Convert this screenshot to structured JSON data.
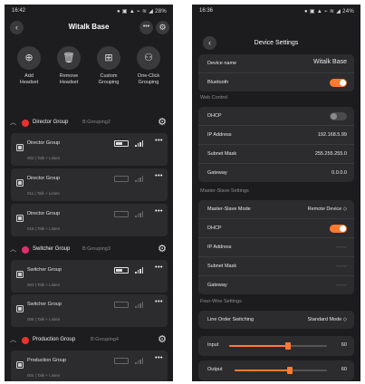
{
  "left": {
    "status": {
      "time": "16:42",
      "icons": "● ▣ ▲ ⌁ ≋ ◢ 28%"
    },
    "title": "Witalk Base",
    "actions": [
      {
        "label": "Add\nHeadset",
        "icon": "add-icon"
      },
      {
        "label": "Remove\nHeadset",
        "icon": "trash-icon"
      },
      {
        "label": "Custom\nGrouping",
        "icon": "grid-icon"
      },
      {
        "label": "One-Click\nGrouping",
        "icon": "people-icon"
      }
    ],
    "groups": [
      {
        "name": "Director Group",
        "number": "B:Grouping2",
        "color": "#e8332f",
        "devices": [
          {
            "name": "Director Group",
            "sub": "002 | Talk + Listen",
            "battery": 0.6,
            "signal": 4
          },
          {
            "name": "Director Group",
            "sub": "011 | Talk + Listen",
            "battery": 0,
            "signal": 0
          },
          {
            "name": "Director Group",
            "sub": "016 | Talk + Listen",
            "battery": 0,
            "signal": 0
          }
        ]
      },
      {
        "name": "Switcher Group",
        "number": "B:Grouping3",
        "color": "#e0306d",
        "devices": [
          {
            "name": "Switcher Group",
            "sub": "003 | Talk + Listen",
            "battery": 0.6,
            "signal": 4
          },
          {
            "name": "Switcher Group",
            "sub": "006 | Talk + Listen",
            "battery": 0,
            "signal": 0
          }
        ]
      },
      {
        "name": "Production Group",
        "number": "B:Grouping4",
        "color": "#e8332f",
        "devices": [
          {
            "name": "Production Group",
            "sub": "004 | Talk + Listen",
            "battery": 0,
            "signal": 0
          }
        ]
      }
    ]
  },
  "right": {
    "status": {
      "time": "16:36",
      "icons": "● ▣ ▲ ⌁ ≋ ◢ 24%"
    },
    "title": "Device Settings",
    "device_name_label": "Device name",
    "device_name_value": "Witalk Base",
    "bluetooth_label": "Bluetooth",
    "bluetooth_on": true,
    "web_control": {
      "title": "Web Control",
      "dhcp_label": "DHCP",
      "dhcp_on": false,
      "ip_label": "IP Address",
      "ip_value": "192.168.5.99",
      "mask_label": "Subnet Mask",
      "mask_value": "255.255.255.0",
      "gateway_label": "Gateway",
      "gateway_value": "0.0.0.0"
    },
    "master_slave": {
      "title": "Master-Slave Settings",
      "mode_label": "Master-Slave Mode",
      "mode_value": "Remote Device ◇",
      "dhcp_label": "DHCP",
      "dhcp_on": true,
      "ip_label": "IP Address",
      "ip_value": "-.-.-.-",
      "mask_label": "Subnet Mask",
      "mask_value": "-.-.-.-",
      "gateway_label": "Gateway",
      "gateway_value": "-.-.-.-"
    },
    "four_wire": {
      "title": "Four-Wire Settings",
      "line_label": "Line Order Switching",
      "line_value": "Standard Mode ◇",
      "input_label": "Input",
      "input_value": "60",
      "input_level": 0.6,
      "output_label": "Output",
      "output_value": "60",
      "output_level": 0.6
    }
  }
}
